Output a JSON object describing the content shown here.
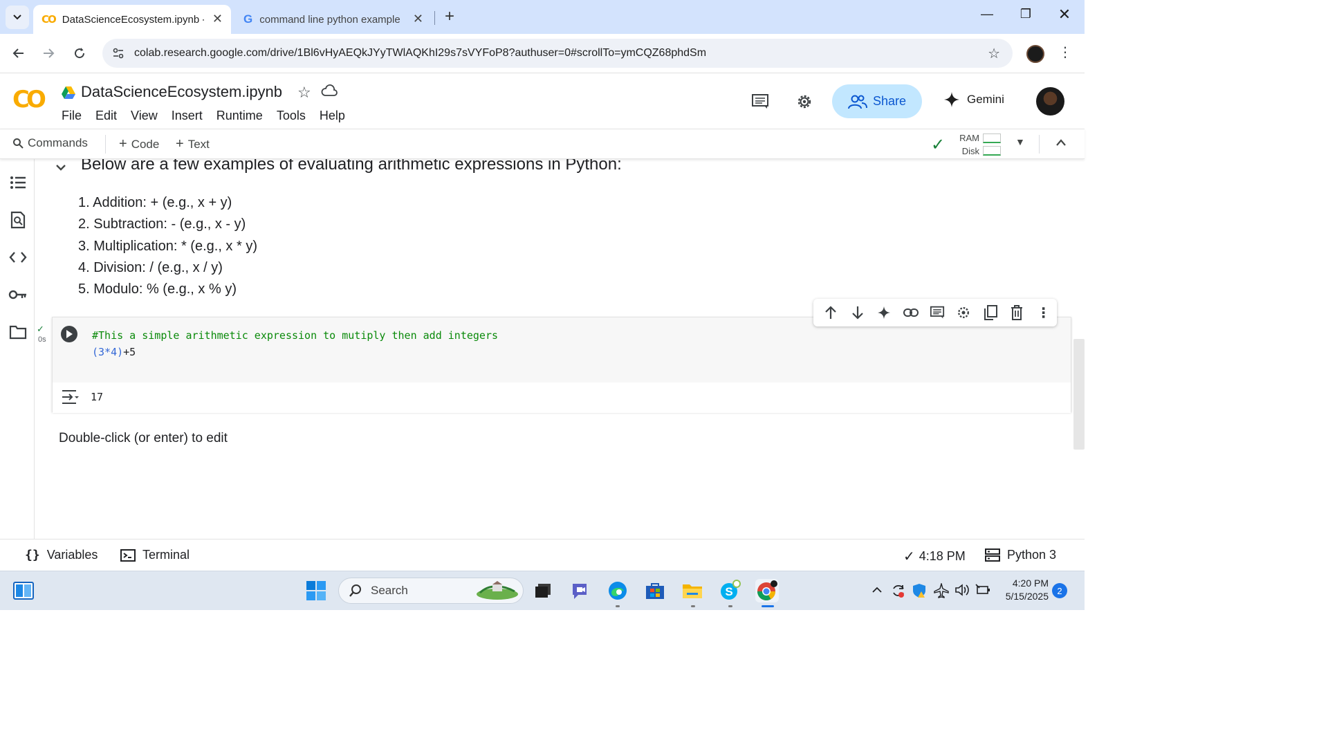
{
  "browser": {
    "tabs": [
      {
        "title": "DataScienceEcosystem.ipynb - C",
        "active": true
      },
      {
        "title": "command line python example",
        "active": false
      }
    ],
    "url": "colab.research.google.com/drive/1Bl6vHyAEQkJYyTWlAQKhI29s7sVYFoP8?authuser=0#scrollTo=ymCQZ68phdSm"
  },
  "colab": {
    "notebook_title": "DataScienceEcosystem.ipynb",
    "menu": [
      "File",
      "Edit",
      "View",
      "Insert",
      "Runtime",
      "Tools",
      "Help"
    ],
    "share_label": "Share",
    "gemini_label": "Gemini"
  },
  "toolbar": {
    "commands_label": "Commands",
    "code_label": "Code",
    "text_label": "Text",
    "ram_label": "RAM",
    "disk_label": "Disk"
  },
  "notebook": {
    "section_heading": "Below are a few examples of evaluating arithmetic expressions in Python:",
    "list_items": [
      "1. Addition: + (e.g., x + y)",
      "2. Subtraction: - (e.g., x - y)",
      "3. Multiplication: * (e.g., x * y)",
      "4. Division: / (e.g., x / y)",
      "5. Modulo: % (e.g., x % y)"
    ],
    "code_cell": {
      "comment_line": "#This a simple arithmetic expression to mutiply then add integers",
      "expr_paren_open": "(3*4)",
      "expr_rest": "+5",
      "exec_time": "0s",
      "output": "17"
    },
    "edit_hint": "Double-click (or enter) to edit"
  },
  "statusbar": {
    "variables_label": "Variables",
    "terminal_label": "Terminal",
    "last_run": "4:18 PM",
    "kernel": "Python 3"
  },
  "taskbar": {
    "search_label": "Search",
    "time": "4:20 PM",
    "date": "5/15/2025",
    "notification_count": "2"
  },
  "colors": {
    "tabstrip": "#d3e3fd",
    "share_bg": "#c2e7ff",
    "accent_blue": "#0b57d0",
    "check_green": "#188038",
    "comment_green": "#0a8a0a"
  }
}
